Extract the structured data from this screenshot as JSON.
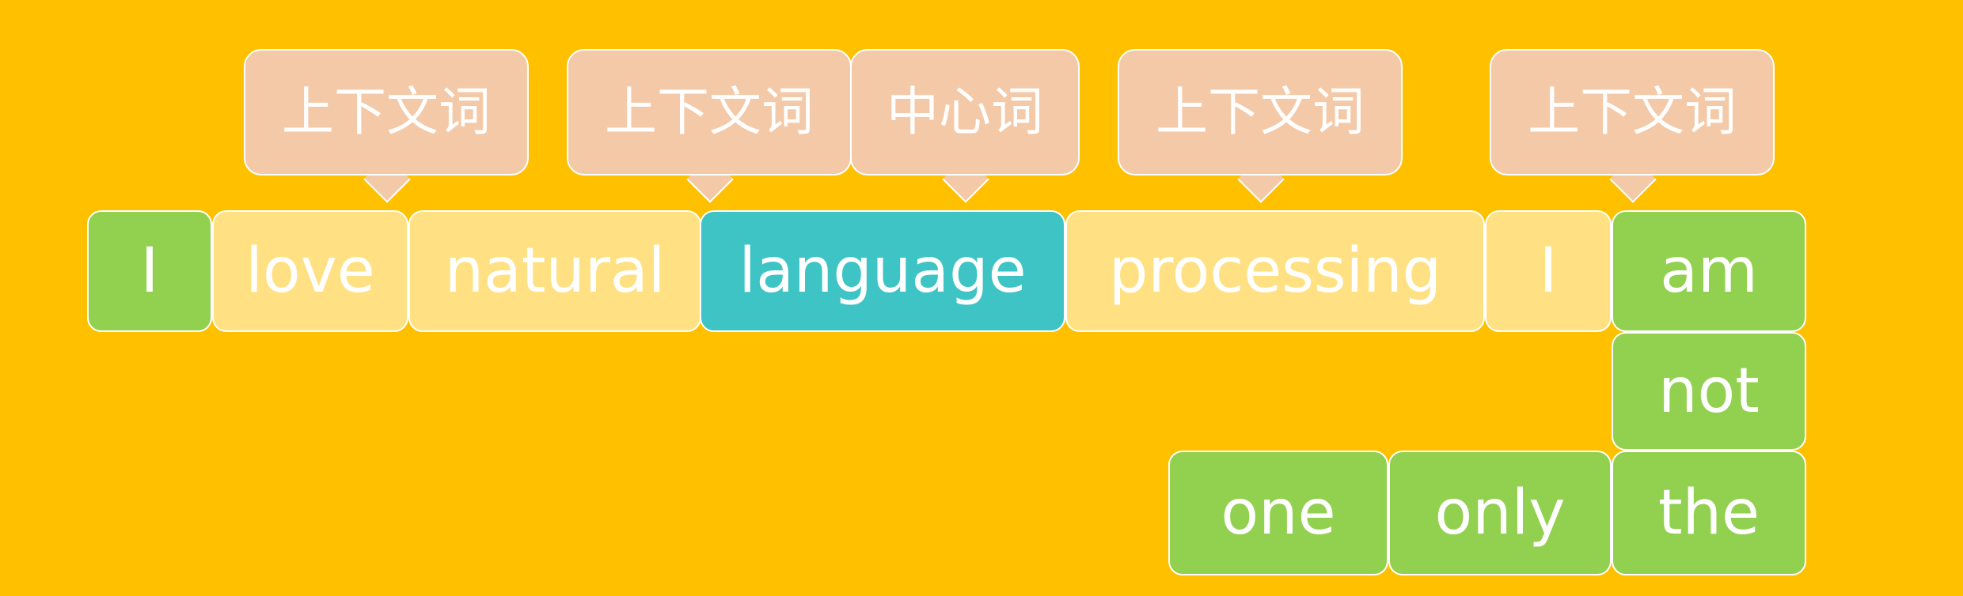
{
  "labels": {
    "context": "上下文词",
    "center": "中心词"
  },
  "row1": [
    "I",
    "love",
    "natural",
    "language",
    "processing",
    "I",
    "am"
  ],
  "column": [
    "not",
    "the"
  ],
  "row3": [
    "one",
    "only"
  ],
  "colors": {
    "background": "#FFC000",
    "green": "#92D050",
    "context_word": "#FFE183",
    "center_word": "#3EC4C4",
    "callout": "#F4C9A8",
    "text": "#FFFFFF"
  }
}
